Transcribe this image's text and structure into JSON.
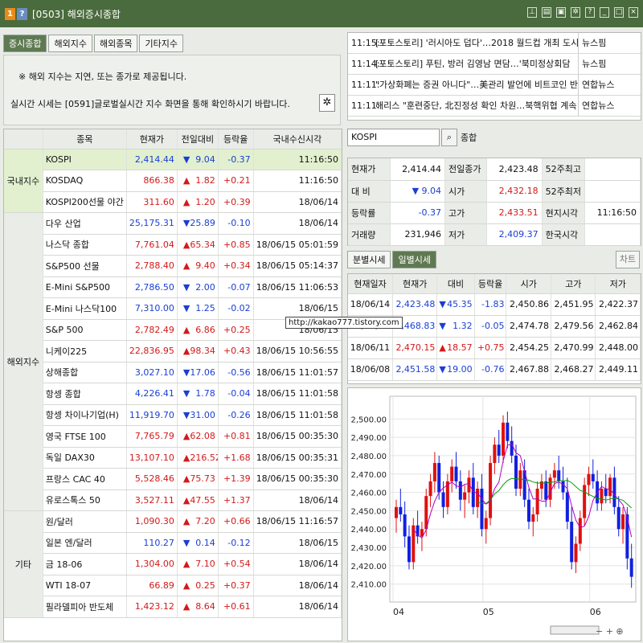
{
  "title": {
    "badge1": "1",
    "badge2": "?",
    "text": "[0503] 해외증시종합"
  },
  "titlebar_icons": [
    "pin-icon",
    "print-icon",
    "save-icon",
    "settings-icon",
    "help-icon",
    "minimize-icon",
    "maximize-icon",
    "close-icon"
  ],
  "tabs": [
    {
      "label": "증시종합"
    },
    {
      "label": "해외지수"
    },
    {
      "label": "해외종목"
    },
    {
      "label": "기타지수"
    }
  ],
  "notice": {
    "line1": "※ 해외 지수는 지연, 또는 종가로 제공됩니다.",
    "line2": "실시간 시세는  [0591]글로벌실시간 지수  화면을 통해 확인하시기 바랍니다."
  },
  "table": {
    "headers": [
      "",
      "종목",
      "현재가",
      "전일대비",
      "등락율",
      "국내수신시각"
    ],
    "rows": [
      {
        "group": "국내지수",
        "name": "KOSPI",
        "price": "2,414.44",
        "dir": "dn",
        "change": "9.04",
        "rate": "-0.37",
        "time": "11:16:50",
        "sel": true
      },
      {
        "group": "",
        "name": "KOSDAQ",
        "price": "866.38",
        "dir": "up",
        "change": "1.82",
        "rate": "+0.21",
        "time": "11:16:50"
      },
      {
        "group": "",
        "name": "KOSPI200선물 야간",
        "price": "311.60",
        "dir": "up",
        "change": "1.20",
        "rate": "+0.39",
        "time": "18/06/14"
      },
      {
        "group": "",
        "name": "다우 산업",
        "price": "25,175.31",
        "dir": "dn",
        "change": "25.89",
        "rate": "-0.10",
        "time": "18/06/14"
      },
      {
        "group": "",
        "name": "나스닥 종합",
        "price": "7,761.04",
        "dir": "up",
        "change": "65.34",
        "rate": "+0.85",
        "time": "18/06/15  05:01:59"
      },
      {
        "group": "",
        "name": "S&P500 선물",
        "price": "2,788.40",
        "dir": "up",
        "change": "9.40",
        "rate": "+0.34",
        "time": "18/06/15  05:14:37"
      },
      {
        "group": "",
        "name": "E-Mini S&P500",
        "price": "2,786.50",
        "dir": "dn",
        "change": "2.00",
        "rate": "-0.07",
        "time": "18/06/15  11:06:53"
      },
      {
        "group": "해외지수",
        "name": "E-Mini 나스닥100",
        "price": "7,310.00",
        "dir": "dn",
        "change": "1.25",
        "rate": "-0.02",
        "time": "18/06/15"
      },
      {
        "group": "",
        "name": "S&P 500",
        "price": "2,782.49",
        "dir": "up",
        "change": "6.86",
        "rate": "+0.25",
        "time": "18/06/15"
      },
      {
        "group": "",
        "name": "니케이225",
        "price": "22,836.95",
        "dir": "up",
        "change": "98.34",
        "rate": "+0.43",
        "time": "18/06/15  10:56:55"
      },
      {
        "group": "",
        "name": "상해종합",
        "price": "3,027.10",
        "dir": "dn",
        "change": "17.06",
        "rate": "-0.56",
        "time": "18/06/15  11:01:57"
      },
      {
        "group": "",
        "name": "항셍 종합",
        "price": "4,226.41",
        "dir": "dn",
        "change": "1.78",
        "rate": "-0.04",
        "time": "18/06/15  11:01:58"
      },
      {
        "group": "",
        "name": "항셍 차이나기업(H)",
        "price": "11,919.70",
        "dir": "dn",
        "change": "31.00",
        "rate": "-0.26",
        "time": "18/06/15  11:01:58"
      },
      {
        "group": "",
        "name": "영국 FTSE 100",
        "price": "7,765.79",
        "dir": "up",
        "change": "62.08",
        "rate": "+0.81",
        "time": "18/06/15  00:35:30"
      },
      {
        "group": "",
        "name": "독일 DAX30",
        "price": "13,107.10",
        "dir": "up",
        "change": "216.52",
        "rate": "+1.68",
        "time": "18/06/15  00:35:31"
      },
      {
        "group": "",
        "name": "프랑스 CAC 40",
        "price": "5,528.46",
        "dir": "up",
        "change": "75.73",
        "rate": "+1.39",
        "time": "18/06/15  00:35:30"
      },
      {
        "group": "",
        "name": "유로스톡스 50",
        "price": "3,527.11",
        "dir": "up",
        "change": "47.55",
        "rate": "+1.37",
        "time": "18/06/14"
      },
      {
        "group": "",
        "name": "원/달러",
        "price": "1,090.30",
        "dir": "up",
        "change": "7.20",
        "rate": "+0.66",
        "time": "18/06/15  11:16:57"
      },
      {
        "group": "",
        "name": "일본 엔/달러",
        "price": "110.27",
        "dir": "dn",
        "change": "0.14",
        "rate": "-0.12",
        "time": "18/06/15"
      },
      {
        "group": "기타",
        "name": "금 18-06",
        "price": "1,304.00",
        "dir": "up",
        "change": "7.10",
        "rate": "+0.54",
        "time": "18/06/14"
      },
      {
        "group": "",
        "name": "WTI 18-07",
        "price": "66.89",
        "dir": "up",
        "change": "0.25",
        "rate": "+0.37",
        "time": "18/06/14"
      },
      {
        "group": "",
        "name": "필라델피아 반도체",
        "price": "1,423.12",
        "dir": "up",
        "change": "8.64",
        "rate": "+0.61",
        "time": "18/06/14"
      }
    ]
  },
  "news": [
    {
      "time": "11:15:",
      "headline": "[포토스토리] '러시아도 덥다'…2018 월드컵 개최 도시",
      "source": "뉴스핌"
    },
    {
      "time": "11:14:",
      "headline": "[포토스토리] 푸틴, 방러 김영남 면담…'북미정상회담",
      "source": "뉴스핌"
    },
    {
      "time": "11:11:",
      "headline": "\"가상화폐는 증권 아니다\"…美관리 발언에 비트코인 반",
      "source": "연합뉴스"
    },
    {
      "time": "11:11:",
      "headline": "해리스 \"훈련중단, 北진정성 확인 차원…북핵위협 계속",
      "source": "연합뉴스"
    }
  ],
  "search": {
    "value": "KOSPI",
    "name": "종합"
  },
  "quote": [
    [
      "현재가",
      "2,414.44",
      "전일종가",
      "2,423.48",
      "52주최고",
      ""
    ],
    [
      "대  비",
      "▼ 9.04",
      "시가",
      "2,432.18",
      "52주최저",
      ""
    ],
    [
      "등락률",
      "-0.37",
      "고가",
      "2,433.51",
      "현지시각",
      "11:16:50"
    ],
    [
      "거래량",
      "231,946",
      "저가",
      "2,409.37",
      "한국시각",
      ""
    ]
  ],
  "tabs2": [
    {
      "label": "분별시세"
    },
    {
      "label": "일별시세"
    }
  ],
  "chart_button": "차트",
  "daily": {
    "headers": [
      "현재일자",
      "현재가",
      "대비",
      "등락율",
      "시가",
      "고가",
      "저가"
    ],
    "rows": [
      [
        "18/06/14",
        "2,423.48",
        "dn",
        "45.35",
        "-1.83",
        "2,450.86",
        "2,451.95",
        "2,422.37"
      ],
      [
        "18/06/12",
        "2,468.83",
        "dn",
        "1.32",
        "-0.05",
        "2,474.78",
        "2,479.56",
        "2,462.84"
      ],
      [
        "18/06/11",
        "2,470.15",
        "up",
        "18.57",
        "+0.75",
        "2,454.25",
        "2,470.99",
        "2,448.00"
      ],
      [
        "18/06/08",
        "2,451.58",
        "dn",
        "19.00",
        "-0.76",
        "2,467.88",
        "2,468.27",
        "2,449.11"
      ]
    ]
  },
  "watermark": "http://kakao777.tistory.com",
  "chart_data": {
    "type": "candlestick",
    "ylim": [
      2402,
      2508
    ],
    "yticks": [
      "2,500.00",
      "2,490.00",
      "2,480.00",
      "2,470.00",
      "2,460.00",
      "2,450.00",
      "2,440.00",
      "2,430.00",
      "2,420.00",
      "2,410.00"
    ],
    "xticks": [
      "04",
      "05",
      "06"
    ],
    "up_color": "#e01010",
    "down_color": "#1020e0",
    "candles": [
      [
        2446,
        2456,
        2438,
        2452
      ],
      [
        2452,
        2462,
        2444,
        2448
      ],
      [
        2448,
        2455,
        2430,
        2436
      ],
      [
        2436,
        2442,
        2418,
        2422
      ],
      [
        2422,
        2446,
        2418,
        2442
      ],
      [
        2442,
        2450,
        2432,
        2436
      ],
      [
        2436,
        2444,
        2428,
        2440
      ],
      [
        2440,
        2462,
        2436,
        2458
      ],
      [
        2458,
        2470,
        2452,
        2466
      ],
      [
        2466,
        2482,
        2460,
        2476
      ],
      [
        2476,
        2480,
        2456,
        2460
      ],
      [
        2460,
        2466,
        2446,
        2452
      ],
      [
        2452,
        2470,
        2448,
        2466
      ],
      [
        2466,
        2478,
        2460,
        2474
      ],
      [
        2474,
        2482,
        2462,
        2466
      ],
      [
        2466,
        2472,
        2450,
        2456
      ],
      [
        2456,
        2464,
        2446,
        2460
      ],
      [
        2460,
        2472,
        2454,
        2468
      ],
      [
        2468,
        2476,
        2448,
        2452
      ],
      [
        2452,
        2466,
        2446,
        2462
      ],
      [
        2462,
        2470,
        2436,
        2440
      ],
      [
        2440,
        2450,
        2432,
        2446
      ],
      [
        2446,
        2480,
        2442,
        2476
      ],
      [
        2476,
        2490,
        2470,
        2486
      ],
      [
        2486,
        2494,
        2476,
        2480
      ],
      [
        2480,
        2502,
        2476,
        2498
      ],
      [
        2498,
        2504,
        2484,
        2488
      ],
      [
        2488,
        2496,
        2476,
        2480
      ],
      [
        2480,
        2486,
        2458,
        2462
      ],
      [
        2462,
        2476,
        2458,
        2472
      ],
      [
        2472,
        2478,
        2452,
        2456
      ],
      [
        2456,
        2462,
        2440,
        2444
      ],
      [
        2444,
        2452,
        2436,
        2448
      ],
      [
        2448,
        2466,
        2444,
        2462
      ],
      [
        2462,
        2470,
        2456,
        2466
      ],
      [
        2466,
        2472,
        2452,
        2456
      ],
      [
        2456,
        2470,
        2452,
        2468
      ],
      [
        2468,
        2476,
        2462,
        2472
      ],
      [
        2472,
        2480,
        2462,
        2466
      ],
      [
        2466,
        2474,
        2456,
        2460
      ],
      [
        2460,
        2468,
        2440,
        2444
      ],
      [
        2444,
        2452,
        2418,
        2422
      ],
      [
        2422,
        2436,
        2416,
        2432
      ],
      [
        2432,
        2450,
        2428,
        2446
      ],
      [
        2446,
        2468,
        2442,
        2464
      ],
      [
        2464,
        2474,
        2458,
        2470
      ],
      [
        2470,
        2478,
        2462,
        2466
      ],
      [
        2466,
        2472,
        2450,
        2454
      ],
      [
        2454,
        2466,
        2450,
        2462
      ],
      [
        2462,
        2470,
        2454,
        2458
      ],
      [
        2458,
        2470,
        2454,
        2468
      ],
      [
        2468,
        2474,
        2448,
        2452
      ],
      [
        2452,
        2458,
        2436,
        2440
      ],
      [
        2440,
        2452,
        2432,
        2448
      ],
      [
        2448,
        2452,
        2418,
        2424
      ],
      [
        2424,
        2432,
        2408,
        2414
      ]
    ],
    "ma_short_color": "#b000c0",
    "ma_long_color": "#00a000"
  }
}
